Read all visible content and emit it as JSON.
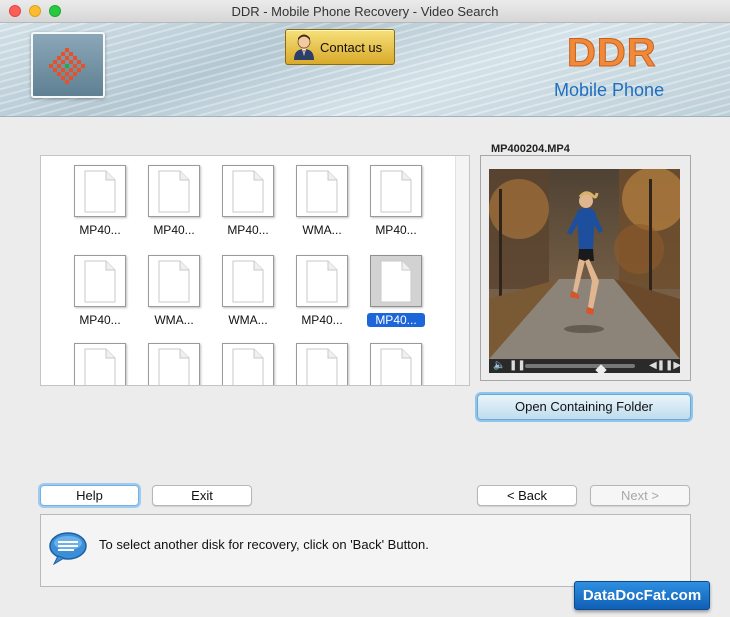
{
  "window": {
    "title": "DDR - Mobile Phone Recovery - Video Search"
  },
  "header": {
    "contact_label": "Contact us",
    "brand": "DDR",
    "brand_sub": "Mobile Phone",
    "brand_color": "#f08a3a",
    "sub_color": "#1f6fbf"
  },
  "files": [
    {
      "name": "MP40...",
      "selected": false
    },
    {
      "name": "MP40...",
      "selected": false
    },
    {
      "name": "MP40...",
      "selected": false
    },
    {
      "name": "WMA...",
      "selected": false
    },
    {
      "name": "MP40...",
      "selected": false
    },
    {
      "name": "MP40...",
      "selected": false
    },
    {
      "name": "WMA...",
      "selected": false
    },
    {
      "name": "WMA...",
      "selected": false
    },
    {
      "name": "MP40...",
      "selected": false
    },
    {
      "name": "MP40...",
      "selected": true
    },
    {
      "name": "",
      "selected": false
    },
    {
      "name": "",
      "selected": false
    },
    {
      "name": "",
      "selected": false
    },
    {
      "name": "",
      "selected": false
    },
    {
      "name": "",
      "selected": false
    }
  ],
  "preview": {
    "filename": "MP400204.MP4",
    "open_folder_label": "Open Containing Folder"
  },
  "buttons": {
    "help": "Help",
    "exit": "Exit",
    "back": "< Back",
    "next": "Next >"
  },
  "status": {
    "message": "To select another disk for recovery, click on 'Back' Button."
  },
  "watermark": "DataDocFat.com"
}
